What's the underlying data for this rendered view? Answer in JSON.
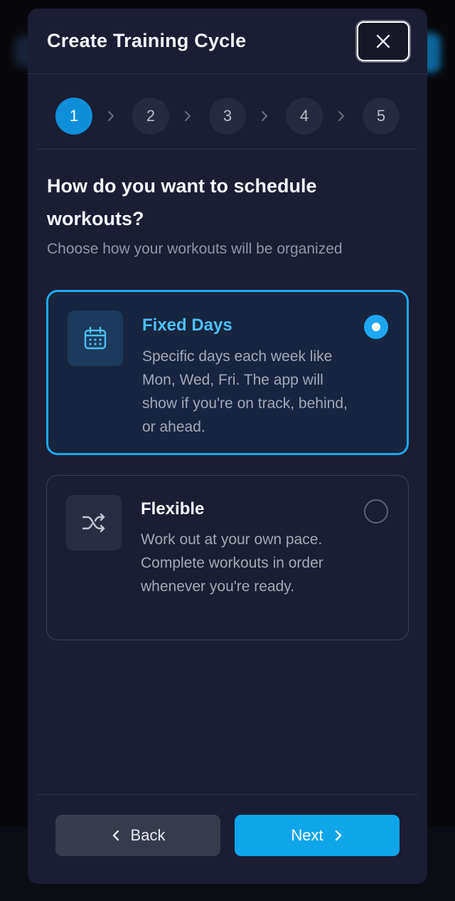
{
  "modal": {
    "title": "Create Training Cycle",
    "close_icon": "close-icon"
  },
  "stepper": {
    "steps": [
      "1",
      "2",
      "3",
      "4",
      "5"
    ],
    "current_step": 1,
    "separator_icon": "chevron-right-icon",
    "active_color": "#0f8fd9"
  },
  "content": {
    "question": "How do you want to schedule workouts?",
    "subtitle": "Choose how your workouts will be organized"
  },
  "options": [
    {
      "id": "fixed",
      "title": "Fixed Days",
      "description": "Specific days each week like Mon, Wed, Fri. The app will show if you're on track, behind, or ahead.",
      "icon": "calendar-icon",
      "selected": true
    },
    {
      "id": "flexible",
      "title": "Flexible",
      "description": "Work out at your own pace. Complete workouts in order whenever you're ready.",
      "icon": "shuffle-icon",
      "selected": false
    }
  ],
  "footer": {
    "back_label": "Back",
    "next_label": "Next",
    "back_icon": "chevron-left-icon",
    "next_icon": "chevron-right-icon"
  },
  "colors": {
    "accent": "#1ea7ef",
    "primary_button": "#0ea5e9",
    "secondary_button": "#373c4d",
    "modal_bg": "#1b1d33"
  }
}
